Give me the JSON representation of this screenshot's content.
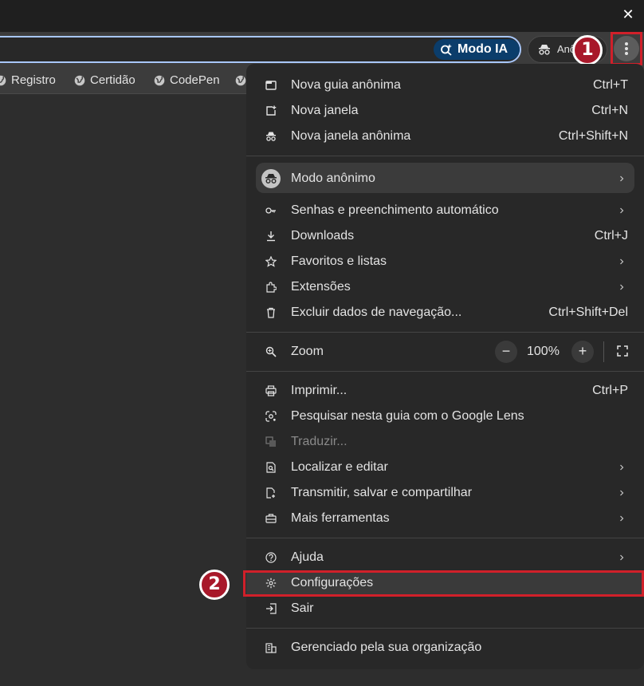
{
  "window": {
    "close_label": "✕"
  },
  "toolbar": {
    "ai_mode_label": "Modo IA",
    "profile_label": "Anônimo"
  },
  "bookmarks": [
    {
      "label": "Registro"
    },
    {
      "label": "Certidão"
    },
    {
      "label": "CodePen"
    }
  ],
  "annotations": {
    "marker_1": "1",
    "marker_2": "2",
    "color": "#d0202a"
  },
  "menu": {
    "new_incognito_tab": {
      "label": "Nova guia anônima",
      "shortcut": "Ctrl+T"
    },
    "new_window": {
      "label": "Nova janela",
      "shortcut": "Ctrl+N"
    },
    "new_incognito_window": {
      "label": "Nova janela anônima",
      "shortcut": "Ctrl+Shift+N"
    },
    "incognito_mode": {
      "label": "Modo anônimo"
    },
    "passwords": {
      "label": "Senhas e preenchimento automático"
    },
    "downloads": {
      "label": "Downloads",
      "shortcut": "Ctrl+J"
    },
    "bookmarks": {
      "label": "Favoritos e listas"
    },
    "extensions": {
      "label": "Extensões"
    },
    "clear_data": {
      "label": "Excluir dados de navegação...",
      "shortcut": "Ctrl+Shift+Del"
    },
    "zoom": {
      "label": "Zoom",
      "value": "100%",
      "minus": "−",
      "plus": "+"
    },
    "print": {
      "label": "Imprimir...",
      "shortcut": "Ctrl+P"
    },
    "lens": {
      "label": "Pesquisar nesta guia com o Google Lens"
    },
    "translate": {
      "label": "Traduzir..."
    },
    "find_edit": {
      "label": "Localizar e editar"
    },
    "cast_save_share": {
      "label": "Transmitir, salvar e compartilhar"
    },
    "more_tools": {
      "label": "Mais ferramentas"
    },
    "help": {
      "label": "Ajuda"
    },
    "settings": {
      "label": "Configurações"
    },
    "exit": {
      "label": "Sair"
    },
    "managed": {
      "label": "Gerenciado pela sua organização"
    }
  }
}
